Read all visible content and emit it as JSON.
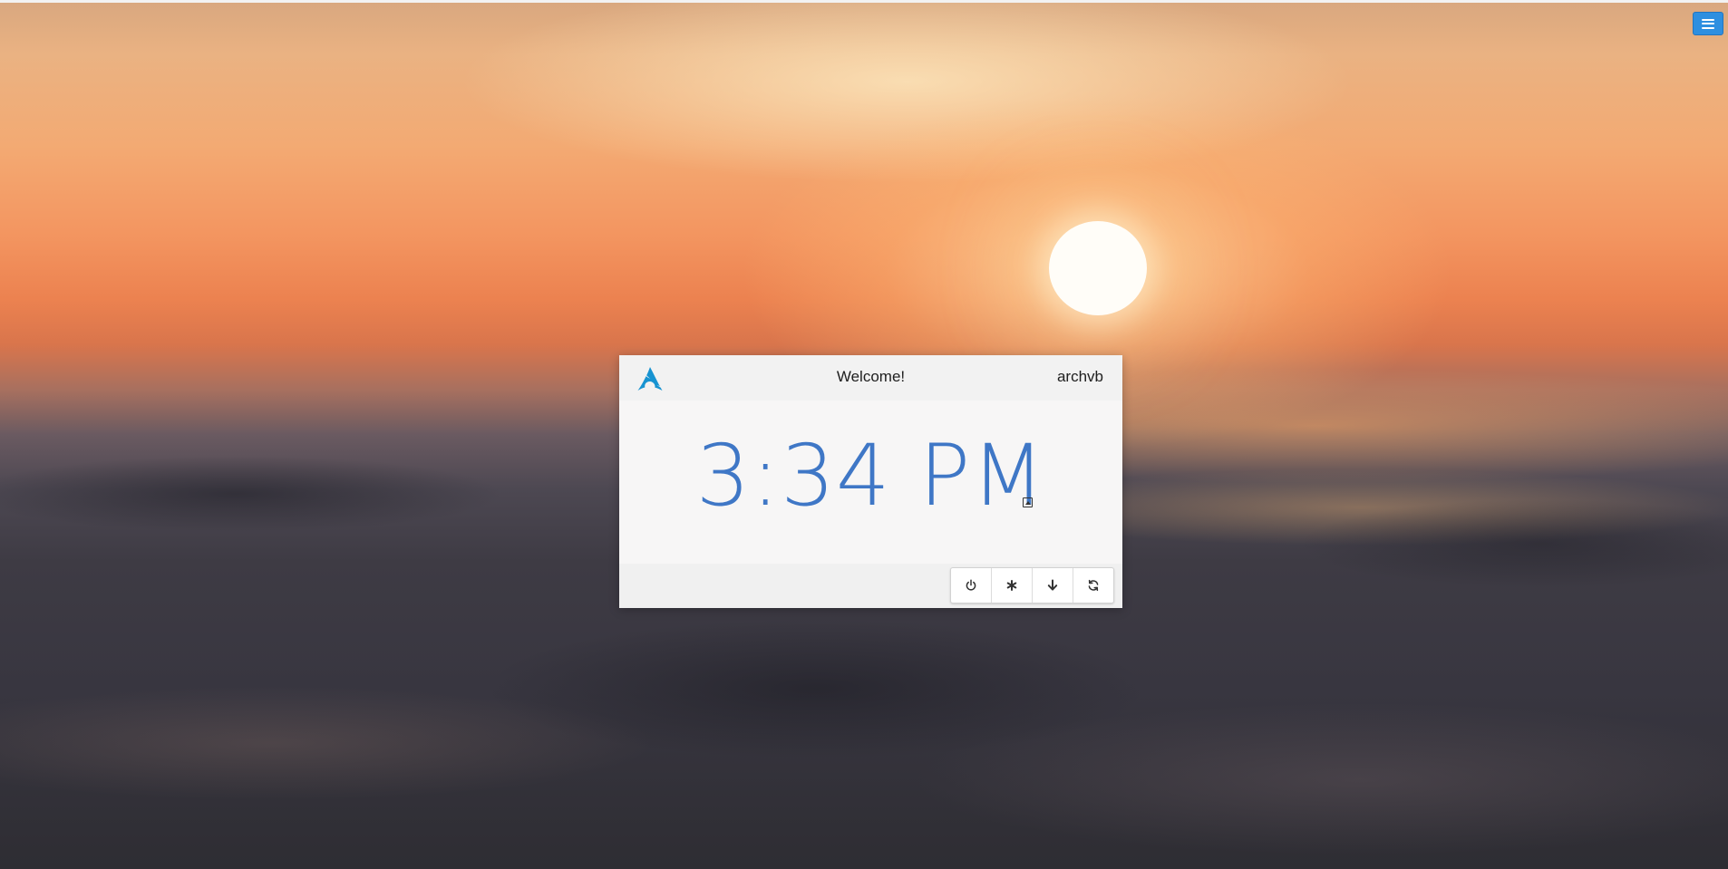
{
  "greeter": {
    "welcome_text": "Welcome!",
    "hostname": "archvb",
    "clock_text": "3:34 PM",
    "logo_icon": "arch-linux-logo-icon"
  },
  "actions": [
    {
      "name": "power-icon",
      "label": "Shutdown"
    },
    {
      "name": "asterisk-icon",
      "label": "Hibernate"
    },
    {
      "name": "arrow-down-icon",
      "label": "Suspend"
    },
    {
      "name": "refresh-icon",
      "label": "Restart"
    }
  ],
  "top_right": {
    "menu_icon": "hamburger-menu-icon"
  },
  "colors": {
    "accent": "#3f77c6",
    "menu_button": "#2e8fe0",
    "logo": "#1793d1"
  }
}
